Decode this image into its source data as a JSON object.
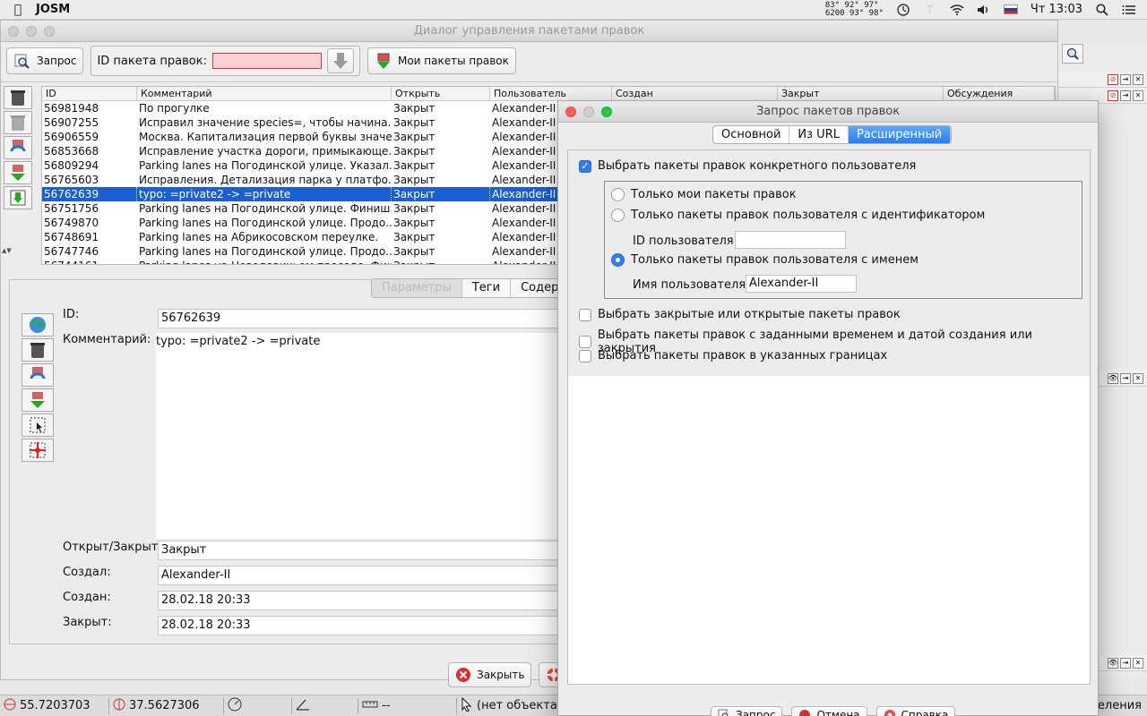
{
  "menubar": {
    "app_name": "JOSM",
    "temps_line1": "83° 92° 97°",
    "temps_line2": "6200 93° 98°",
    "clock": "Чт 13:03"
  },
  "main_window": {
    "title": "Диалог управления пакетами правок",
    "toolbar": {
      "query_label": "Запрос",
      "changeset_id_label": "ID пакета правок:",
      "my_changesets_label": "Мои пакеты правок"
    },
    "table": {
      "columns": [
        "ID",
        "Комментарий",
        "Открыть",
        "Пользователь",
        "Создан",
        "Закрыт",
        "Обсуждения"
      ],
      "rows": [
        {
          "id": "56981948",
          "comment": "По прогулке",
          "state": "Закрыт",
          "user": "Alexander-II"
        },
        {
          "id": "56907255",
          "comment": "Исправил значение species=, чтобы начина...",
          "state": "Закрыт",
          "user": "Alexander-II"
        },
        {
          "id": "56906559",
          "comment": "Москва. Капитализация первой буквы значе...",
          "state": "Закрыт",
          "user": "Alexander-II"
        },
        {
          "id": "56853668",
          "comment": "Исправление участка дороги, примыкающе...",
          "state": "Закрыт",
          "user": "Alexander-II"
        },
        {
          "id": "56809294",
          "comment": "Parking lanes на Погодинской улице. Указал...",
          "state": "Закрыт",
          "user": "Alexander-II"
        },
        {
          "id": "56765603",
          "comment": "Исправления. Детализация парка у платфо...",
          "state": "Закрыт",
          "user": "Alexander-II"
        },
        {
          "id": "56762639",
          "comment": "typo: =private2 -> =private",
          "state": "Закрыт",
          "user": "Alexander-II"
        },
        {
          "id": "56751756",
          "comment": "Parking lanes на Погодинской улице. Финиш.",
          "state": "Закрыт",
          "user": "Alexander-II"
        },
        {
          "id": "56749870",
          "comment": "Parking lanes на Погодинской улице. Продо...",
          "state": "Закрыт",
          "user": "Alexander-II"
        },
        {
          "id": "56748691",
          "comment": "Parking lanes на Абрикосовском переулке.",
          "state": "Закрыт",
          "user": "Alexander-II"
        },
        {
          "id": "56747746",
          "comment": "Parking lanes на Погодинской улице. Продо...",
          "state": "Закрыт",
          "user": "Alexander-II"
        },
        {
          "id": "56744161",
          "comment": "Parking lanes на Новодевичьем проезде. Фик...",
          "state": "Закрыт",
          "user": "Alexander-II"
        }
      ],
      "selected_index": 6
    },
    "detail_tabs": [
      "Параметры",
      "Теги",
      "Содерж"
    ],
    "detail": {
      "id_label": "ID:",
      "id_value": "56762639",
      "comment_label": "Комментарий:",
      "comment_value": "typo: =private2 -> =private",
      "state_label": "Открыт/Закрыт:",
      "state_value": "Закрыт",
      "creator_label": "Создал:",
      "creator_value": "Alexander-II",
      "created_label": "Создан:",
      "created_value": "28.02.18 20:33",
      "closed_label": "Закрыт:",
      "closed_value": "28.02.18 20:33"
    },
    "close_button": "Закрыть"
  },
  "statusbar": {
    "lat": "55.7203703",
    "lon": "37.5627306",
    "dist": "--",
    "no_object": "(нет объекта)",
    "right_text": "еления"
  },
  "dialog": {
    "title": "Запрос пакетов правок",
    "tabs": [
      "Основной",
      "Из URL",
      "Расширенный"
    ],
    "active_tab": 2,
    "options": {
      "specific_user": "Выбрать пакеты правок конкретного пользователя",
      "only_mine": "Только мои пакеты правок",
      "by_id": "Только пакеты правок пользователя с идентификатором",
      "user_id_label": "ID пользователя:",
      "user_id_value": "",
      "by_name": "Только пакеты правок пользователя с именем",
      "user_name_label": "Имя пользователя:",
      "user_name_value": "Alexander-II",
      "closed_or_open": "Выбрать закрытые или открытые пакеты правок",
      "by_time": "Выбрать пакеты правок с заданными временем и датой создания или закрытия",
      "in_bounds": "Выбрать пакеты правок в указанных границах"
    },
    "footer": {
      "query": "Запрос",
      "cancel": "Отмена",
      "help": "Справка"
    }
  },
  "colors": {
    "selection": "#1b5fd6",
    "accent_tab": "#2a7df3",
    "error_field": "#fbd2d2"
  }
}
